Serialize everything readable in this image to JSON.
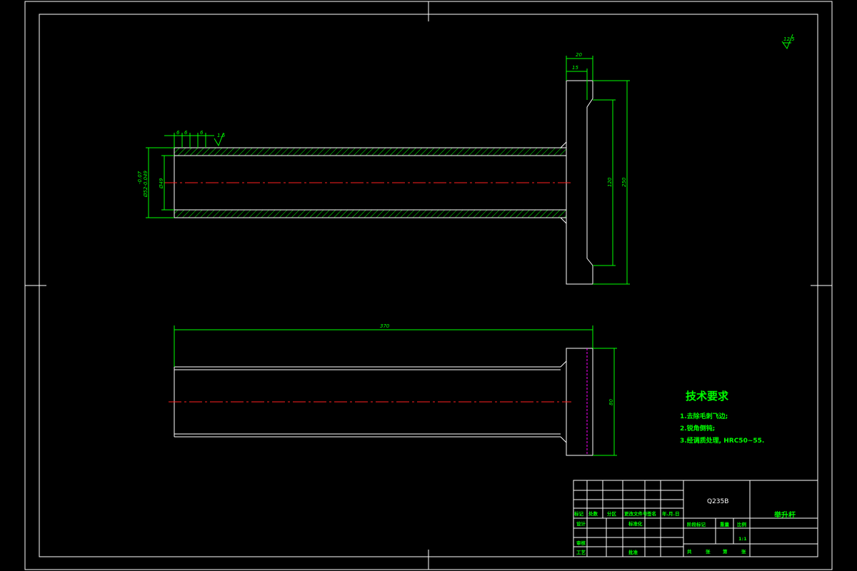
{
  "colors": {
    "background": "#000000",
    "outline": "#ffffff",
    "dimension": "#00ff00",
    "centerline": "#ff2020",
    "hidden_line": "#ff00ff",
    "hatch": "#00ff00"
  },
  "roughness": {
    "general": "12.5",
    "bore": "1.6"
  },
  "dimensions": {
    "flange_thickness": "20",
    "step_depth": "15",
    "flange_height": "250",
    "flange_inner": "120",
    "outer_diameter": "Ø52-0.049",
    "outer_tol_upper": "-0.07",
    "bore_diameter": "Ø49",
    "total_length": "370",
    "flange_width": "80",
    "groove_1": "6",
    "groove_2": "6",
    "groove_3": "6"
  },
  "tech_requirements": {
    "title": "技术要求",
    "items": [
      "1.去除毛刺飞边;",
      "2.锐角倒钝;",
      "3.经调质处理, HRC50~55."
    ]
  },
  "title_block": {
    "material": "Q235B",
    "part_name": "举升杆",
    "scale": "1:1",
    "headers": [
      "标记",
      "处数",
      "分区",
      "更改文件号",
      "签名",
      "年.月.日"
    ],
    "roles": [
      "设计",
      "审核",
      "工艺"
    ],
    "labels": {
      "standardization": "标准化",
      "approve": "批准",
      "stage_mark": "阶段标记",
      "weight": "重量",
      "ratio": "比例",
      "sheet_total": "共",
      "sheet_word": "张",
      "sheet_no": "第",
      "sheet_word2": "张"
    }
  }
}
